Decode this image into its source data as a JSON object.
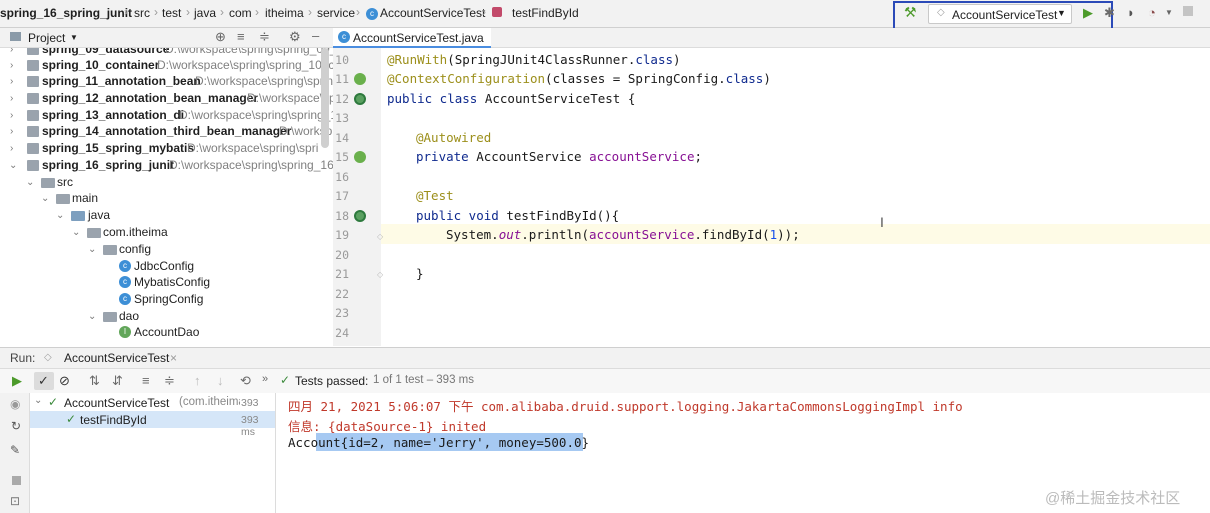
{
  "breadcrumb": [
    {
      "label": "spring_16_spring_junit",
      "bold": true
    },
    {
      "label": "src"
    },
    {
      "label": "test"
    },
    {
      "label": "java"
    },
    {
      "label": "com"
    },
    {
      "label": "itheima"
    },
    {
      "label": "service"
    },
    {
      "label": "AccountServiceTest"
    },
    {
      "label": "testFindById"
    }
  ],
  "run_config": {
    "label": "AccountServiceTest"
  },
  "project_pane": {
    "title": "Project"
  },
  "tree": [
    {
      "label": "spring_09_datasource",
      "path": "D:\\workspace\\spring\\spring_09_..."
    },
    {
      "label": "spring_10_container",
      "path": "D:\\workspace\\spring\\spring_10_co"
    },
    {
      "label": "spring_11_annotation_bean",
      "path": "D:\\workspace\\spring\\sprin"
    },
    {
      "label": "spring_12_annotation_bean_manager",
      "path": "D:\\workspace\\sp"
    },
    {
      "label": "spring_13_annotation_di",
      "path": "D:\\workspace\\spring\\spring_1"
    },
    {
      "label": "spring_14_annotation_third_bean_manager",
      "path": "D:\\worksp"
    },
    {
      "label": "spring_15_spring_mybatis",
      "path": "D:\\workspace\\spring\\spri"
    },
    {
      "label": "spring_16_spring_junit",
      "path": "D:\\workspace\\spring\\spring_16_"
    },
    {
      "label": "src"
    },
    {
      "label": "main"
    },
    {
      "label": "java"
    },
    {
      "label": "com.itheima"
    },
    {
      "label": "config"
    },
    {
      "label": "JdbcConfig"
    },
    {
      "label": "MybatisConfig"
    },
    {
      "label": "SpringConfig"
    },
    {
      "label": "dao"
    },
    {
      "label": "AccountDao"
    }
  ],
  "editor": {
    "tab": "AccountServiceTest.java",
    "lines": [
      "10",
      "11",
      "12",
      "13",
      "14",
      "15",
      "16",
      "17",
      "18",
      "19",
      "20",
      "21",
      "22",
      "23",
      "24"
    ],
    "code": {
      "l10_a": "@RunWith",
      "l10_b": "(SpringJUnit4ClassRunner.",
      "l10_c": "class",
      "l10_d": ")",
      "l11_a": "@ContextConfiguration",
      "l11_b": "(classes = SpringConfig.",
      "l11_c": "class",
      "l11_d": ")",
      "l12_a": "public class ",
      "l12_b": "AccountServiceTest {",
      "l14": "@Autowired",
      "l15_a": "private ",
      "l15_b": "AccountService ",
      "l15_c": "accountService",
      "l15_d": ";",
      "l17": "@Test",
      "l18_a": "public void ",
      "l18_b": "testFindById(){",
      "l19_a": "System.",
      "l19_b": "out",
      "l19_c": ".println(",
      "l19_d": "accountService",
      ".": "",
      "l19_e": ".findById(",
      "l19_f": "1",
      "l19_g": "));",
      "l21": "}"
    }
  },
  "run_panel": {
    "label": "Run:",
    "tab": "AccountServiceTest",
    "status": "Tests passed:",
    "status_detail": "1 of 1 test – 393 ms",
    "tests": [
      {
        "name": "AccountServiceTest",
        "pkg": "(com.itheima.s",
        "time": "393 ms"
      },
      {
        "name": "testFindById",
        "time": "393 ms"
      }
    ],
    "output": [
      "四月 21, 2021 5:06:07 下午 com.alibaba.druid.support.logging.JakartaCommonsLoggingImpl info",
      "信息: {dataSource-1} inited",
      "Account{id=2, name='Jerry', money=500.0}"
    ]
  },
  "watermark": "@稀土掘金技术社区",
  "colors": {
    "accent": "#2b4ab8",
    "pass": "#3c8a3c",
    "selection": "#a6c9f2"
  }
}
